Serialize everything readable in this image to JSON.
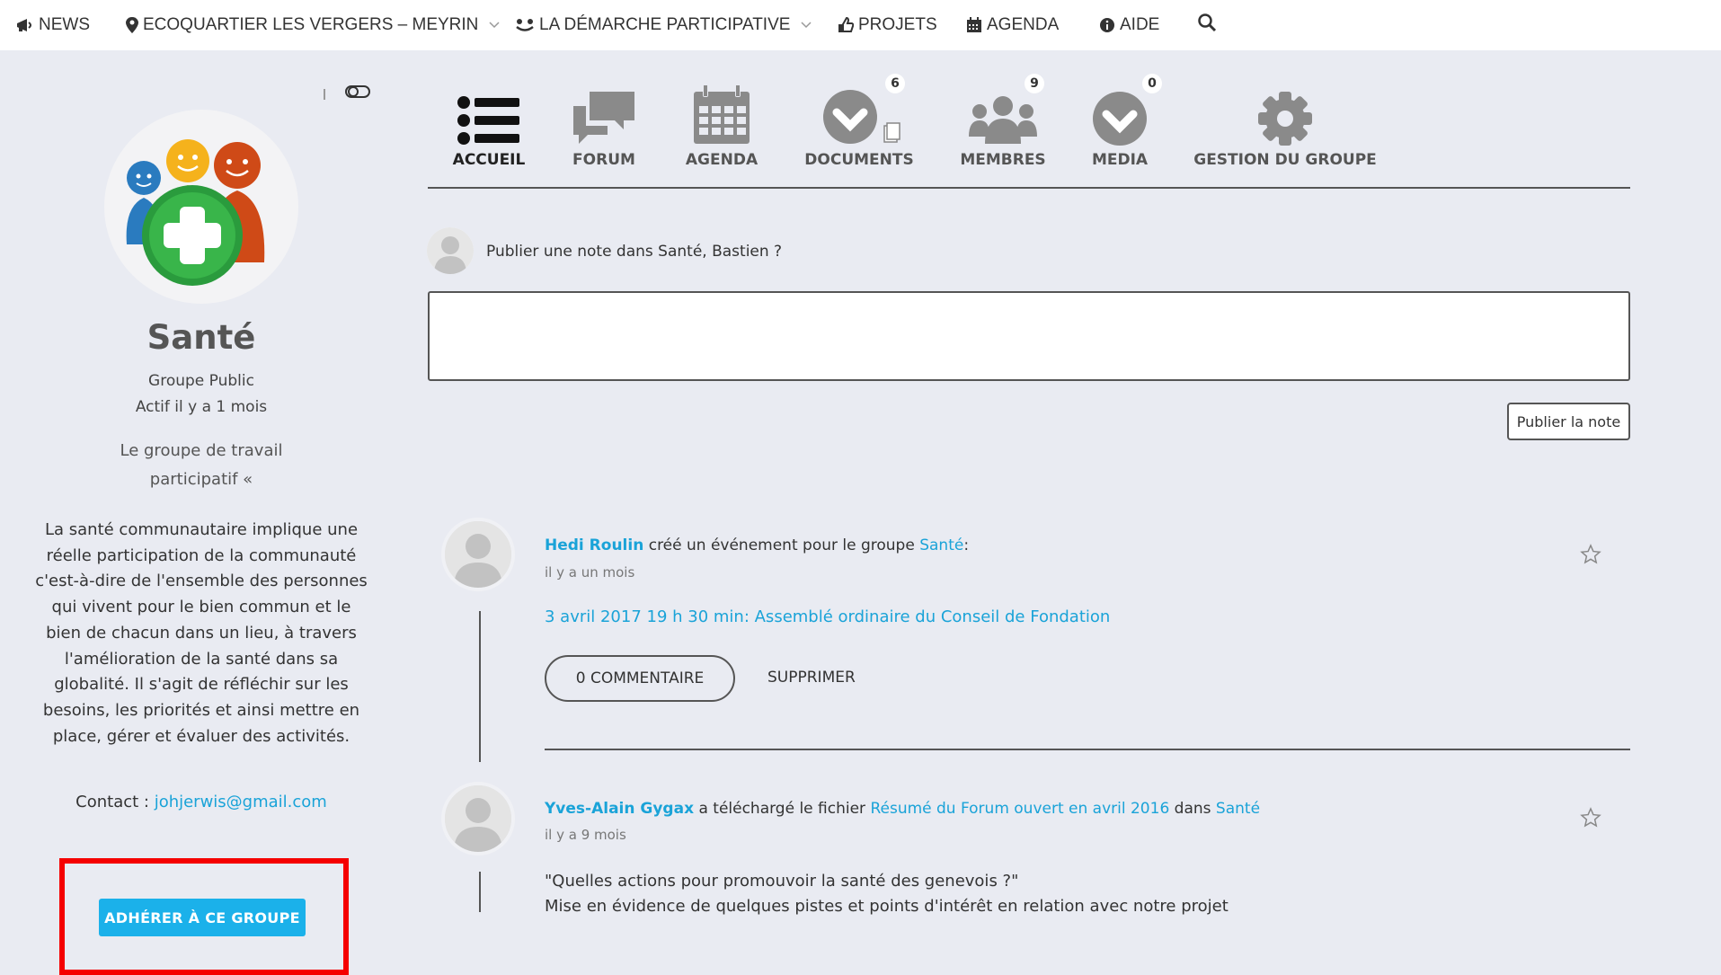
{
  "nav": {
    "items": [
      {
        "label": "NEWS",
        "icon": "megaphone-icon"
      },
      {
        "label": "ECOQUARTIER LES VERGERS – MEYRIN",
        "icon": "map-marker-icon",
        "dropdown": true
      },
      {
        "label": "LA DÉMARCHE PARTICIPATIVE",
        "icon": "people-icon",
        "dropdown": true
      },
      {
        "label": "PROJETS",
        "icon": "thumbs-up-icon"
      },
      {
        "label": "AGENDA",
        "icon": "calendar-icon"
      },
      {
        "label": "AIDE",
        "icon": "info-icon"
      }
    ],
    "search_icon": "search-icon"
  },
  "group": {
    "name": "Santé",
    "type": "Groupe Public",
    "active": "Actif il y a 1 mois",
    "tagline": "Le groupe de travail participatif «",
    "description": "La santé communautaire implique une réelle participation de la communauté c'est-à-dire de l'ensemble des personnes qui vivent pour le bien commun et le bien de chacun dans un lieu, à travers l'amélioration de la santé dans sa globalité. Il s'agit de réfléchir sur les besoins, les priorités et ainsi mettre en place, gérer et évaluer des activités.",
    "contact_label": "Contact : ",
    "contact_email": "johjerwis@gmail.com",
    "join_label": "ADHÉRER À CE GROUPE"
  },
  "tabs": [
    {
      "label": "ACCUEIL",
      "icon": "list-icon",
      "active": true
    },
    {
      "label": "FORUM",
      "icon": "chat-bubbles-icon"
    },
    {
      "label": "AGENDA",
      "icon": "calendar-icon"
    },
    {
      "label": "DOCUMENTS",
      "icon": "documents-icon",
      "badge": "6"
    },
    {
      "label": "MEMBRES",
      "icon": "members-icon",
      "badge": "9"
    },
    {
      "label": "MEDIA",
      "icon": "media-icon",
      "badge": "0"
    },
    {
      "label": "GESTION DU GROUPE",
      "icon": "gear-icon"
    }
  ],
  "post_box": {
    "prompt": "Publier une note dans Santé, Bastien ?",
    "textarea_value": "",
    "publish_label": "Publier la note"
  },
  "activities": [
    {
      "user": "Hedi Roulin",
      "action": " créé un événement pour le groupe ",
      "target": "Santé",
      "suffix": ":",
      "time": "il y a un mois",
      "link": "3 avril 2017 19 h 30 min: Assemblé ordinaire du Conseil de Fondation",
      "comment_label": "0  COMMENTAIRE",
      "delete_label": "SUPPRIMER"
    },
    {
      "user": "Yves-Alain Gygax",
      "action": " a téléchargé le fichier ",
      "file": "Résumé du Forum ouvert en avril 2016",
      "in_word": " dans ",
      "target": "Santé",
      "time": "il y a 9 mois",
      "text1": "\"Quelles actions pour promouvoir la santé des genevois ?\"",
      "text2": "Mise en évidence de quelques pistes et points d'intérêt en relation avec notre projet"
    }
  ],
  "colors": {
    "accent": "#1aa3d8",
    "join_button": "#1bb1ea",
    "highlight": "#f50000",
    "background": "#e9ebf2"
  }
}
